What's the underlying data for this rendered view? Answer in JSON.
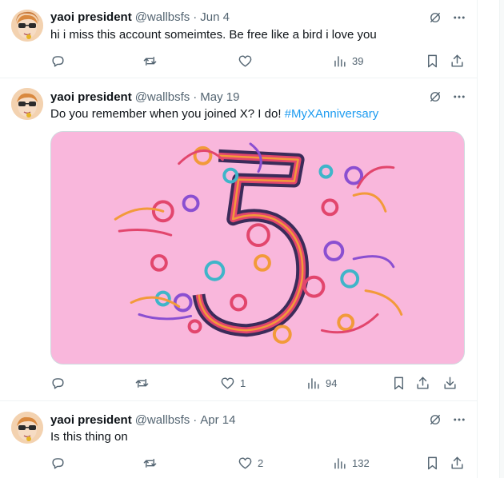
{
  "tweets": [
    {
      "author": "yaoi president",
      "handle": "@wallbsfs",
      "separator": "·",
      "date": "Jun 4",
      "text": "hi i miss this account someimtes. Be free like a bird i love you",
      "replies": "",
      "reposts": "",
      "likes": "",
      "views": "39"
    },
    {
      "author": "yaoi president",
      "handle": "@wallbsfs",
      "separator": "·",
      "date": "May 19",
      "text": "Do you remember when you joined X? I do! ",
      "hashtag": "#MyXAnniversary",
      "media_alt": "Paper quilling artwork of the number 5",
      "replies": "",
      "reposts": "",
      "likes": "1",
      "views": "94"
    },
    {
      "author": "yaoi president",
      "handle": "@wallbsfs",
      "separator": "·",
      "date": "Apr 14",
      "text": "Is this thing on",
      "replies": "",
      "reposts": "",
      "likes": "2",
      "views": "132"
    }
  ],
  "icons": {
    "reply": "reply-icon",
    "repost": "repost-icon",
    "like": "like-icon",
    "views": "views-icon",
    "bookmark": "bookmark-icon",
    "share": "share-icon",
    "download": "download-icon",
    "grok": "grok-icon",
    "more": "more-icon"
  },
  "colors": {
    "text": "#0f1419",
    "muted": "#536471",
    "link": "#1d9bf0",
    "media_background": "#f9b7dc"
  }
}
